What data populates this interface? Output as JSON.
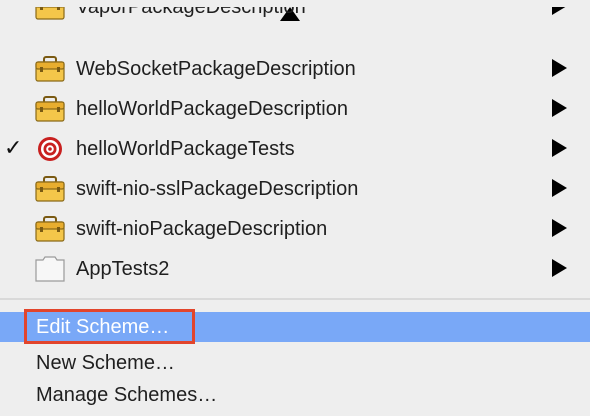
{
  "menu": {
    "items": [
      {
        "label": "VaporPackageDescription",
        "icon": "package-icon",
        "checked": false,
        "submenu": true
      },
      {
        "label": "WebSocketPackageDescription",
        "icon": "package-icon",
        "checked": false,
        "submenu": true
      },
      {
        "label": "helloWorldPackageDescription",
        "icon": "package-icon",
        "checked": false,
        "submenu": true
      },
      {
        "label": "helloWorldPackageTests",
        "icon": "target-icon",
        "checked": true,
        "submenu": true
      },
      {
        "label": "swift-nio-sslPackageDescription",
        "icon": "package-icon",
        "checked": false,
        "submenu": true
      },
      {
        "label": "swift-nioPackageDescription",
        "icon": "package-icon",
        "checked": false,
        "submenu": true
      },
      {
        "label": "AppTests2",
        "icon": "blank-target-icon",
        "checked": false,
        "submenu": true
      }
    ],
    "check_glyph": "✓",
    "actions": [
      {
        "label": "Edit Scheme…",
        "highlighted": true
      },
      {
        "label": "New Scheme…",
        "highlighted": false
      },
      {
        "label": "Manage Schemes…",
        "highlighted": false
      }
    ],
    "colors": {
      "highlight": "#79a8f7",
      "focus_outline": "#e2452c",
      "background": "#eeeeee"
    }
  }
}
